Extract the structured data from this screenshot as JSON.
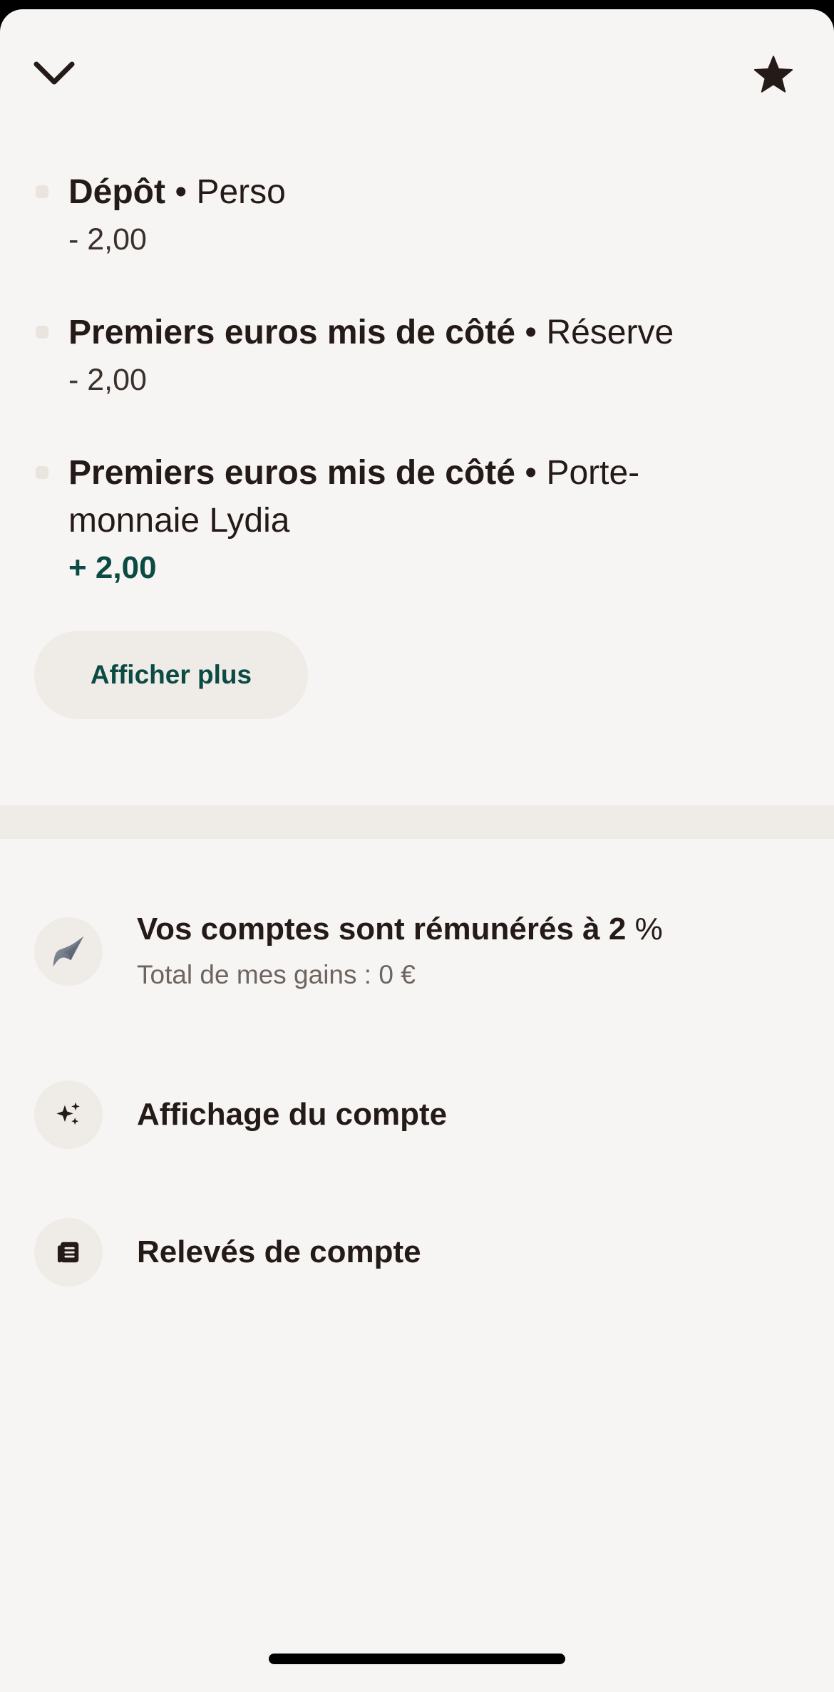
{
  "header": {
    "back_icon": "chevron-down-icon",
    "favorite_icon": "star-icon"
  },
  "transactions": [
    {
      "title": "Dépôt",
      "separator": " • ",
      "account": "Perso",
      "amount": "- 2,00",
      "direction": "negative"
    },
    {
      "title": "Premiers euros mis de côté",
      "separator": " • ",
      "account": "Réserve",
      "amount": "- 2,00",
      "direction": "negative"
    },
    {
      "title": "Premiers euros mis de côté",
      "separator": " • ",
      "account": "Porte-monnaie Lydia",
      "amount": "+ 2,00",
      "direction": "positive"
    }
  ],
  "show_more_label": "Afficher plus",
  "options": {
    "interest": {
      "title_prefix": "Vos comptes sont rémunérés à ",
      "rate_value": "2",
      "rate_unit": " %",
      "subtitle": "Total de mes gains : 0 €",
      "icon": "sparkle-icon"
    },
    "display": {
      "title": "Affichage du compte",
      "icon": "sparkles-icon"
    },
    "statements": {
      "title": "Relevés de compte",
      "icon": "document-icon"
    }
  },
  "colors": {
    "background": "#f7f5f3",
    "text": "#241a17",
    "accent": "#0c4a44",
    "chip": "#efebe6"
  }
}
